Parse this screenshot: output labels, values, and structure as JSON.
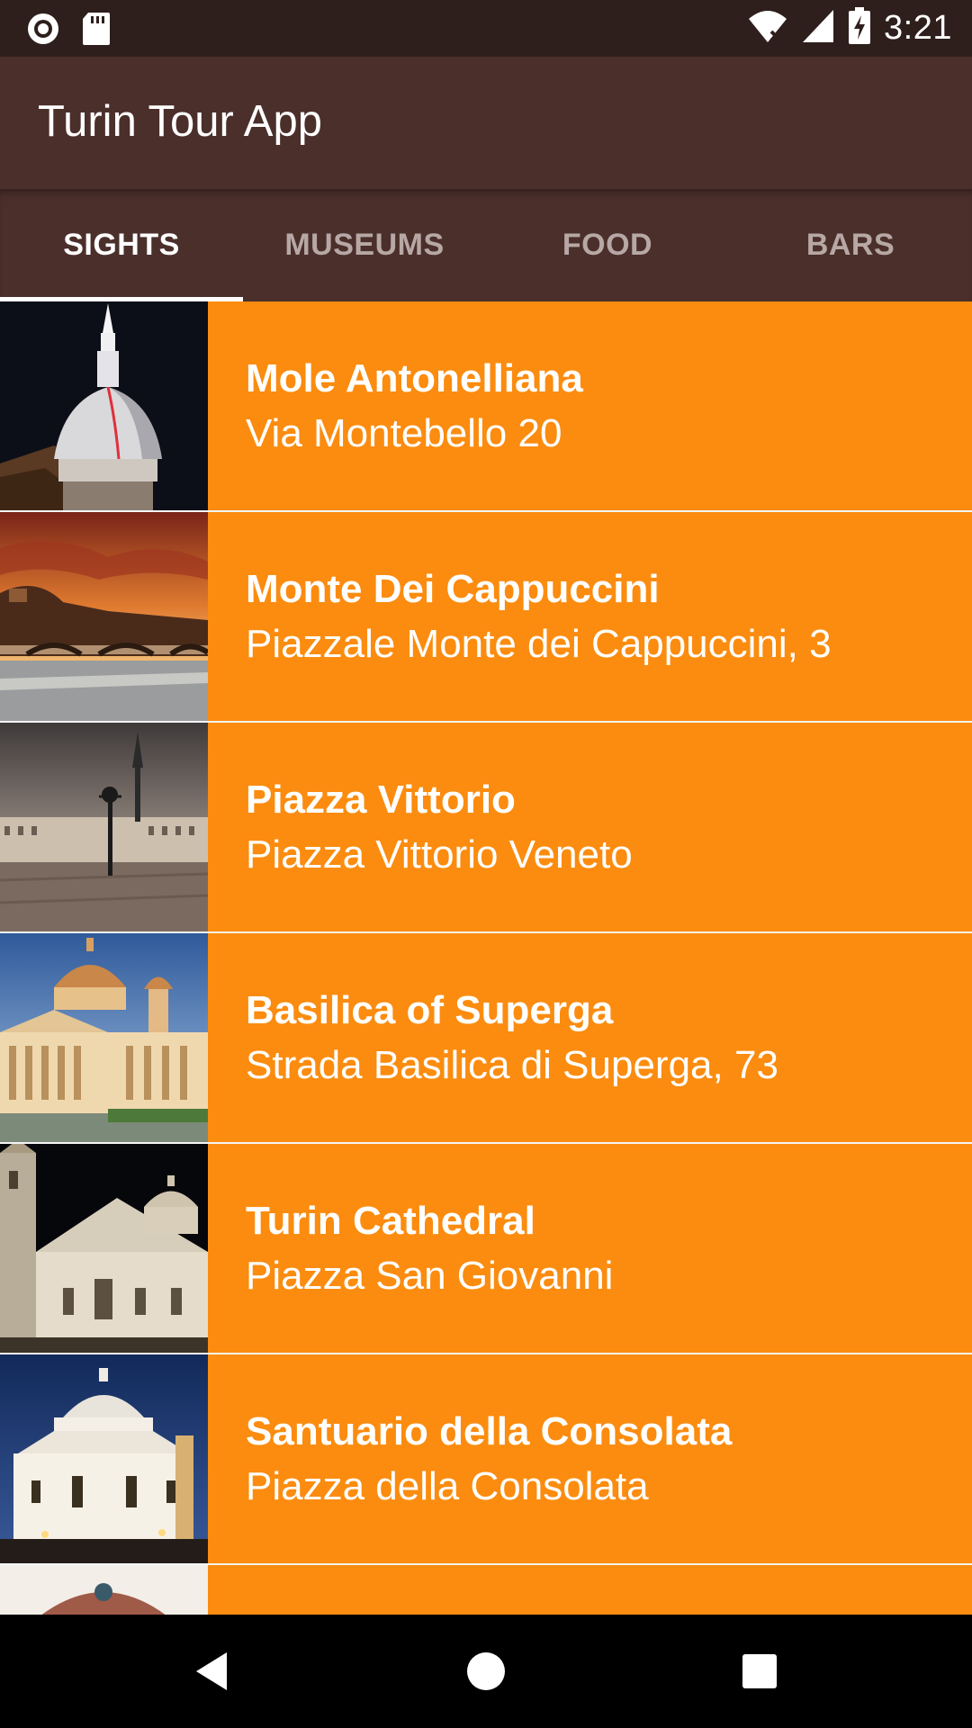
{
  "status_bar": {
    "time": "3:21",
    "icons": [
      "record-icon",
      "sd-card-icon",
      "wifi-icon",
      "signal-icon",
      "battery-charging-icon"
    ]
  },
  "app_bar": {
    "title": "Turin Tour App",
    "color": "#4b2f2b"
  },
  "tabs": [
    {
      "label": "SIGHTS",
      "selected": true
    },
    {
      "label": "MUSEUMS",
      "selected": false
    },
    {
      "label": "FOOD",
      "selected": false
    },
    {
      "label": "BARS",
      "selected": false
    }
  ],
  "list": {
    "accent": "#fb8c0f",
    "items": [
      {
        "title": "Mole Antonelliana",
        "address": "Via Montebello 20"
      },
      {
        "title": "Monte Dei Cappuccini",
        "address": "Piazzale Monte dei Cappuccini, 3"
      },
      {
        "title": "Piazza Vittorio",
        "address": "Piazza Vittorio Veneto"
      },
      {
        "title": "Basilica of Superga",
        "address": "Strada Basilica di Superga, 73"
      },
      {
        "title": "Turin Cathedral",
        "address": "Piazza San Giovanni"
      },
      {
        "title": "Santuario della Consolata",
        "address": "Piazza della Consolata"
      }
    ]
  },
  "nav_bar": {
    "icons": [
      "back-icon",
      "home-icon",
      "recents-icon"
    ]
  }
}
